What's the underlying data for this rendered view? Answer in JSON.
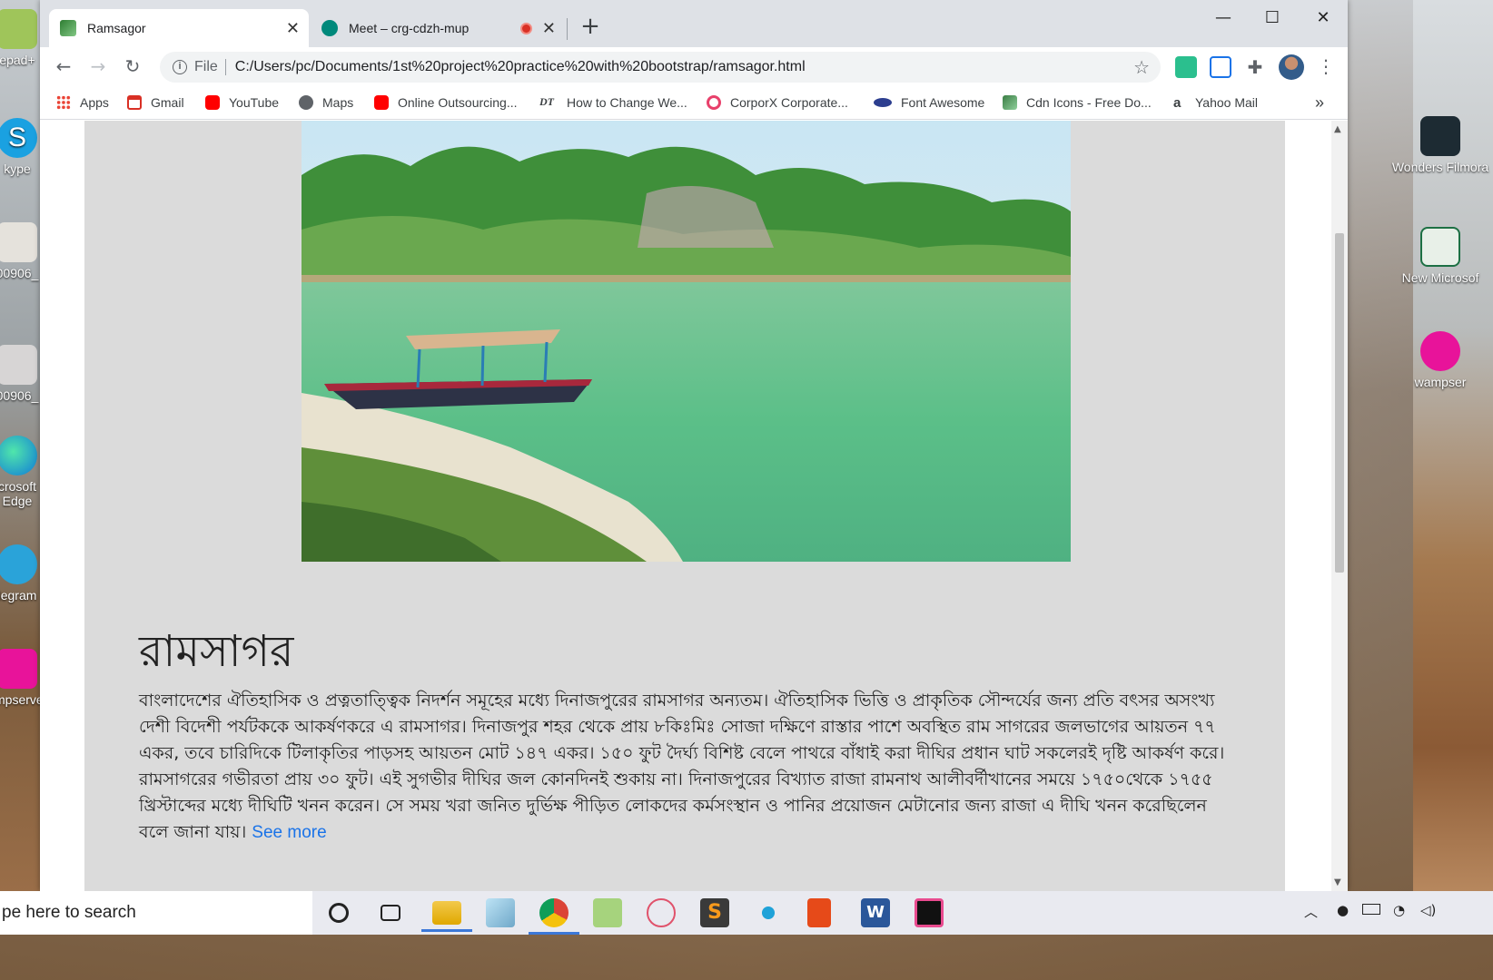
{
  "browser": {
    "tabs": [
      {
        "title": "Ramsagor",
        "active": true
      },
      {
        "title": "Meet – crg-cdzh-mup",
        "active": false,
        "recording": true
      }
    ],
    "new_tab_symbol": "+",
    "address": {
      "scheme_label": "File",
      "url": "C:/Users/pc/Documents/1st%20project%20practice%20with%20bootstrap/ramsagor.html"
    },
    "bookmarks": [
      {
        "label": "Apps",
        "icon": "apps-grid-icon",
        "color": "#ea4335"
      },
      {
        "label": "Gmail",
        "icon": "gmail-icon",
        "color": "#d93025"
      },
      {
        "label": "YouTube",
        "icon": "youtube-icon",
        "color": "#ff0000"
      },
      {
        "label": "Maps",
        "icon": "globe-icon",
        "color": "#5f6368"
      },
      {
        "label": "Online Outsourcing...",
        "icon": "youtube-icon",
        "color": "#ff0000"
      },
      {
        "label": "How to Change We...",
        "icon": "dt-logo-icon",
        "color": "#000000"
      },
      {
        "label": "CorporX Corporate...",
        "icon": "corporx-logo-icon",
        "color": "#e8406b"
      },
      {
        "label": "Font Awesome",
        "icon": "font-awesome-icon",
        "color": "#2c3e8f"
      },
      {
        "label": "Cdn Icons - Free Do...",
        "icon": "cdn-icons-icon",
        "color": "#3a7d44"
      },
      {
        "label": "Yahoo Mail",
        "icon": "amazon-a-icon",
        "color": "#000000"
      }
    ],
    "bookmarks_overflow": "»"
  },
  "page": {
    "title": "রামসাগর",
    "description": "বাংলাদেশের ঐতিহাসিক ও প্রত্নতাত্ত্বিক নিদর্শন সমূহের মধ্যে দিনাজপুরের রামসাগর অন্যতম। ঐতিহাসিক ভিত্তি ও প্রাকৃতিক সৌন্দর্যের জন্য প্রতি বৎসর অসংখ্য দেশী বিদেশী পর্যটককে আকর্ষণকরে এ রামসাগর। দিনাজপুর শহর থেকে প্রায় ৮কিঃমিঃ সোজা দক্ষিণে রাস্তার পাশে অবস্থিত রাম সাগরের জলভাগের আয়তন ৭৭ একর, তবে চারিদিকে টিলাকৃতির পাড়সহ আয়তন মোট ১৪৭ একর। ১৫০ ফুট দৈর্ঘ্য বিশিষ্ট বেলে পাথরে বাঁধাই করা দীঘির প্রধান ঘাট সকলেরই দৃষ্টি আকর্ষণ করে। রামসাগরের গভীরতা প্রায় ৩০ ফুট। এই সুগভীর দীঘির জল কোনদিনই শুকায় না। দিনাজপুরের বিখ্যাত রাজা রামনাথ আলীবর্দীখানের সময়ে ১৭৫০থেকে ১৭৫৫ খ্রিস্টাব্দের মধ্যে দীঘিটি খনন করেন। সে সময় খরা জনিত দুর্ভিক্ষ পীড়িত লোকদের কর্মসংস্থান ও পানির প্রয়োজন মেটানোর জন্য রাজা এ দীঘি খনন করেছিলেন বলে জানা যায়।",
    "see_more_label": "See more",
    "colors": {
      "card_bg": "#dbdbdb",
      "link": "#1a73e8"
    }
  },
  "desktop": {
    "left_icons": [
      "epad+",
      "kype",
      "00906_",
      "00906_",
      "crosoft Edge",
      "legram",
      "mpserve"
    ],
    "right_icons": [
      "Wonders Filmora",
      "New Microsof",
      "wampser"
    ]
  },
  "taskbar": {
    "search_placeholder": "pe here to search",
    "apps": [
      "cortana-circle-icon",
      "task-view-icon",
      "file-explorer-icon",
      "notepad-icon",
      "chrome-icon",
      "notepad-plus-icon",
      "snipping-tool-icon",
      "sublime-text-icon",
      "loader-icon",
      "office-icon",
      "word-icon",
      "intellij-icon"
    ]
  }
}
